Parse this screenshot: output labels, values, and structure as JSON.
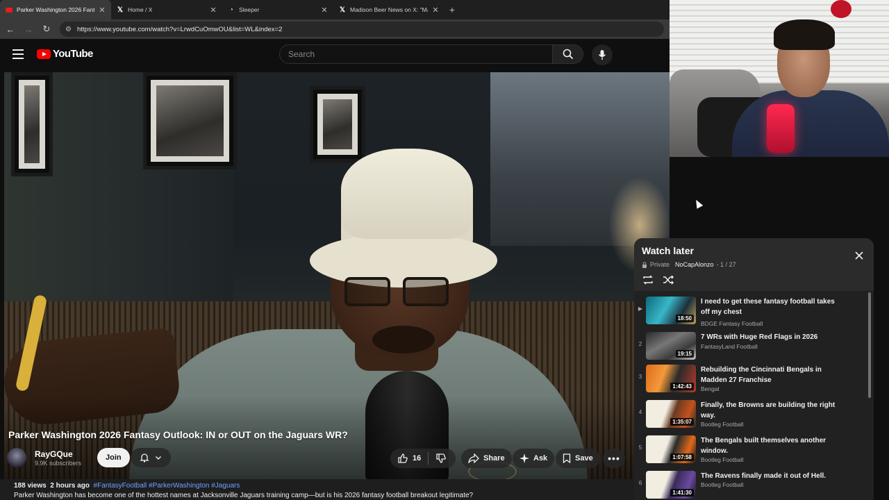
{
  "browser": {
    "tabs": [
      {
        "label": "Parker Washington 2026 Fanta",
        "favicon": "youtube-icon",
        "active": true
      },
      {
        "label": "Home / X",
        "favicon": "x-icon",
        "active": false
      },
      {
        "label": "Sleeper",
        "favicon": "sleeper-icon",
        "active": false
      },
      {
        "label": "Madison Beer News on X: \"Ma",
        "favicon": "x-icon",
        "active": false
      }
    ],
    "new_tab": "+",
    "url": "https://www.youtube.com/watch?v=LrwdCuOmwOU&list=WL&index=2"
  },
  "header": {
    "logo_text": "YouTube",
    "search_placeholder": "Search"
  },
  "video": {
    "title": "Parker Washington 2026 Fantasy Outlook: IN or OUT on the Jaguars WR?",
    "channel": "RayGQue",
    "subscribers": "9.9K subscribers",
    "join_label": "Join",
    "likes": "16",
    "share_label": "Share",
    "ask_label": "Ask",
    "save_label": "Save",
    "views": "188 views",
    "time_ago": "2 hours ago",
    "hashtags": "#FantasyFootball #ParkerWashington #Jaguars",
    "description": "Parker Washington has become one of the hottest names at Jacksonville Jaguars training camp—but is his 2026 fantasy football breakout legitimate?"
  },
  "playlist": {
    "title": "Watch later",
    "privacy": "Private",
    "owner": "NoCapAlonzo",
    "position": "- 1 / 27",
    "items": [
      {
        "index": "▶",
        "title": "I need to get these fantasy football takes off my chest",
        "channel": "BDGE Fantasy Football",
        "duration": "18:50"
      },
      {
        "index": "2",
        "title": "7 WRs with Huge Red Flags in 2026",
        "channel": "FantasyLand Football",
        "duration": "19:15"
      },
      {
        "index": "3",
        "title": "Rebuilding the Cincinnati Bengals in Madden 27 Franchise",
        "channel": "Bengal",
        "duration": "1:42:43"
      },
      {
        "index": "4",
        "title": "Finally, the Browns are building the right way.",
        "channel": "Bootleg Football",
        "duration": "1:35:07"
      },
      {
        "index": "5",
        "title": "The Bengals built themselves another window.",
        "channel": "Bootleg Football",
        "duration": "1:07:58"
      },
      {
        "index": "6",
        "title": "The Ravens finally made it out of Hell.",
        "channel": "Bootleg Football",
        "duration": "1:41:30"
      }
    ]
  },
  "colors": {
    "youtube_red": "#ff0000",
    "background": "#0f0f0f",
    "panel": "#212121",
    "hashtag": "#6ea3ff"
  }
}
